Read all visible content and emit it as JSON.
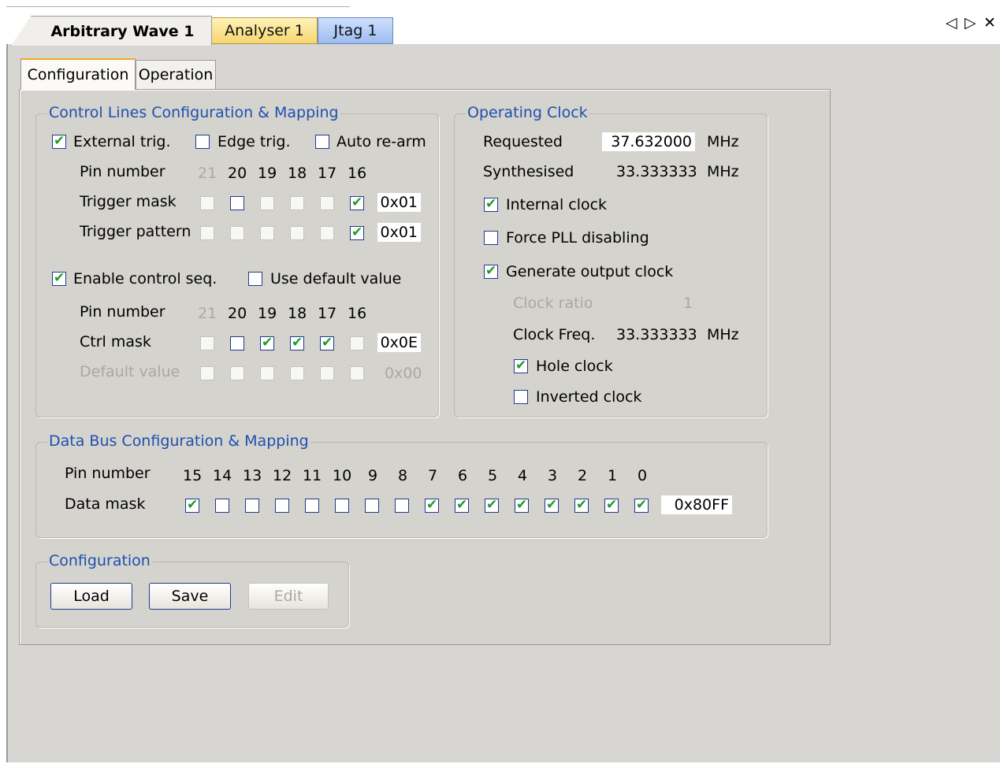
{
  "doc_tabs": [
    "Arbitrary Wave 1",
    "Analyser 1",
    "Jtag 1"
  ],
  "nav": {
    "prev": "◁",
    "next": "▷",
    "close": "✕"
  },
  "inner_tabs": [
    "Configuration",
    "Operation"
  ],
  "control_lines": {
    "title": "Control Lines Configuration & Mapping",
    "external_trig": "External trig.",
    "edge_trig": "Edge trig.",
    "auto_rearm": "Auto re-arm",
    "pin_number_label": "Pin number",
    "pins": [
      "21",
      "20",
      "19",
      "18",
      "17",
      "16"
    ],
    "trigger_mask_label": "Trigger mask",
    "trigger_mask_value": "0x01",
    "trigger_pattern_label": "Trigger pattern",
    "trigger_pattern_value": "0x01",
    "enable_control_seq": "Enable control seq.",
    "use_default_value": "Use default value",
    "ctrl_mask_label": "Ctrl mask",
    "ctrl_mask_value": "0x0E",
    "default_value_label": "Default value",
    "default_value_value": "0x00"
  },
  "operating_clock": {
    "title": "Operating Clock",
    "requested_label": "Requested",
    "requested_value": "37.632000",
    "requested_unit": "MHz",
    "synthesised_label": "Synthesised",
    "synthesised_value": "33.333333",
    "synthesised_unit": "MHz",
    "internal_clock": "Internal clock",
    "force_pll": "Force PLL disabling",
    "generate_output": "Generate output clock",
    "clock_ratio_label": "Clock ratio",
    "clock_ratio_value": "1",
    "clock_freq_label": "Clock Freq.",
    "clock_freq_value": "33.333333",
    "clock_freq_unit": "MHz",
    "hole_clock": "Hole clock",
    "inverted_clock": "Inverted clock"
  },
  "data_bus": {
    "title": "Data Bus Configuration & Mapping",
    "pin_number_label": "Pin number",
    "pins": [
      "15",
      "14",
      "13",
      "12",
      "11",
      "10",
      "9",
      "8",
      "7",
      "6",
      "5",
      "4",
      "3",
      "2",
      "1",
      "0"
    ],
    "data_mask_label": "Data mask",
    "data_mask_value": "0x80FF"
  },
  "config": {
    "title": "Configuration",
    "load": "Load",
    "save": "Save",
    "edit": "Edit"
  }
}
